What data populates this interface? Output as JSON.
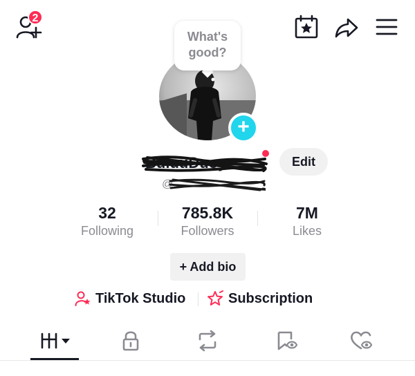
{
  "header": {
    "notification_count": "2",
    "icons": [
      "add-friend-icon",
      "creator-calendar-icon",
      "share-icon",
      "menu-icon"
    ]
  },
  "avatar": {
    "bubble_text_line1": "What's",
    "bubble_text_line2": "good?",
    "add_icon": "+"
  },
  "profile": {
    "display_name": "BuluuDuoy",
    "username": "@",
    "edit_label": "Edit"
  },
  "stats": [
    {
      "value": "32",
      "label": "Following"
    },
    {
      "value": "785.8K",
      "label": "Followers"
    },
    {
      "value": "7M",
      "label": "Likes"
    }
  ],
  "add_bio_label": "+ Add bio",
  "links": {
    "studio_label": "TikTok Studio",
    "subscription_label": "Subscription"
  },
  "tabs": [
    "videos-grid-icon",
    "private-lock-icon",
    "repost-icon",
    "favorites-icon",
    "liked-icon"
  ],
  "colors": {
    "accent": "#fe2c55",
    "cyan": "#20d5ec",
    "text": "#161823",
    "secondary": "#8a8b91",
    "button_bg": "#f1f1f2"
  }
}
